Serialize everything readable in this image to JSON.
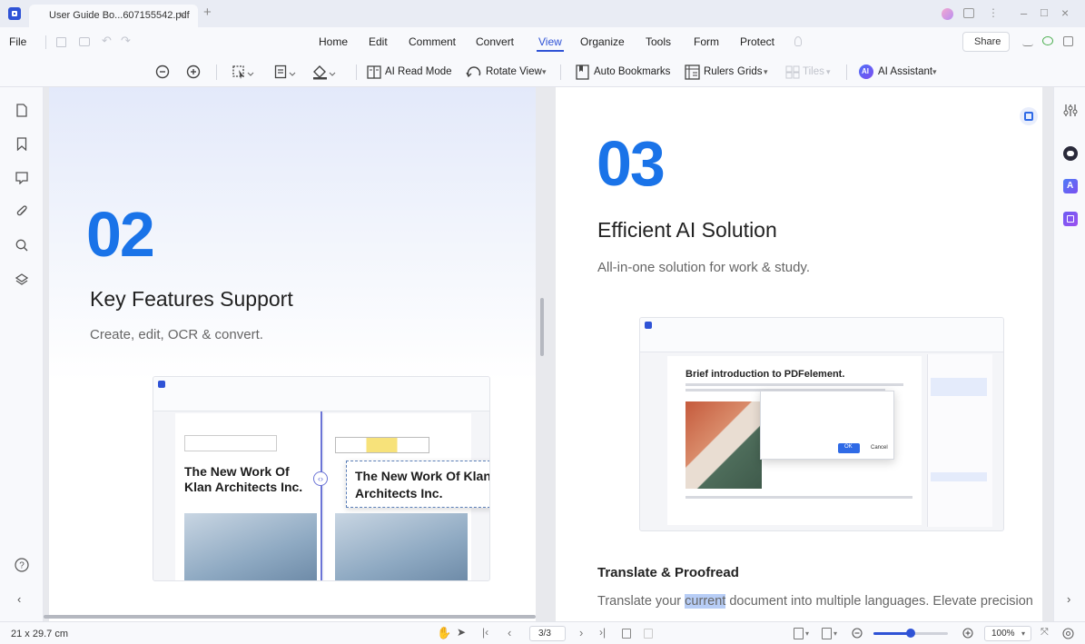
{
  "window": {
    "tab_title": "User Guide Bo...607155542.pdf",
    "tab_close": "×",
    "new_tab": "+",
    "controls": [
      "–",
      "□",
      "×"
    ]
  },
  "menu": {
    "file": "File",
    "items": [
      "Home",
      "Edit",
      "Comment",
      "Convert",
      "View",
      "Organize",
      "Tools",
      "Form",
      "Protect"
    ],
    "active": "View",
    "share": "Share"
  },
  "toolbar": {
    "ai_read_mode": "AI Read Mode",
    "rotate_view": "Rotate View",
    "auto_bookmarks": "Auto Bookmarks",
    "rulers": "Rulers",
    "grids": "Grids",
    "tiles": "Tiles",
    "ai_assistant": "AI Assistant",
    "dropdown_caret": "▾"
  },
  "left_page": {
    "number": "02",
    "title": "Key Features Support",
    "subtitle": "Create, edit, OCR & convert.",
    "screenshot_text_left": "The New Work Of Klan Architects Inc.",
    "screenshot_text_right": "The New Work Of Klan Architects Inc."
  },
  "right_page": {
    "number": "03",
    "title": "Efficient AI Solution",
    "subtitle": "All-in-one solution for work & study.",
    "screenshot_heading": "Brief introduction to PDFelement.",
    "dialog_ok": "OK",
    "dialog_cancel": "Cancel",
    "section_title": "Translate & Proofread",
    "body_before": "Translate your ",
    "body_highlight": "current",
    "body_after": " document into multiple languages. Elevate precision"
  },
  "statusbar": {
    "page_size": "21 x 29.7 cm",
    "page_indicator": "3/3",
    "zoom": "100%",
    "zoom_level": 0.5
  },
  "colors": {
    "accent": "#1a73e8",
    "menu_active": "#2f53d6",
    "highlight": "#b7cdf6"
  }
}
